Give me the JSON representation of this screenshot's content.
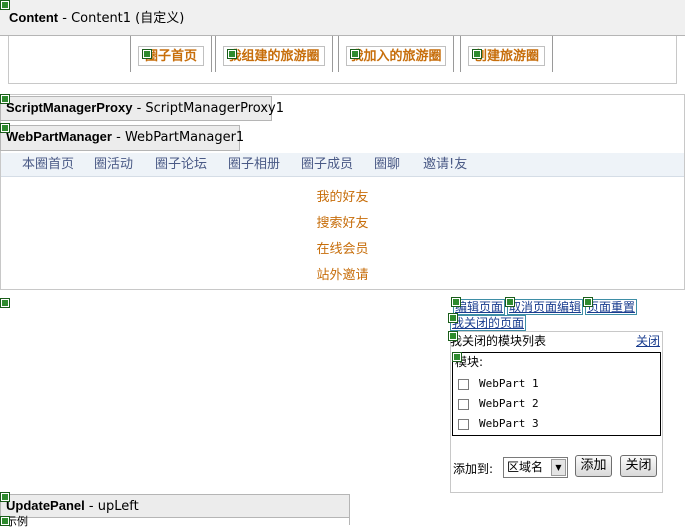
{
  "content_control": {
    "type": "Content",
    "id": "Content1 (自定义)"
  },
  "top_tabs": [
    "圈子首页",
    "我组建的旅游圈",
    "我加入的旅游圈",
    "创建旅游圈"
  ],
  "script_manager_proxy": {
    "type": "ScriptManagerProxy",
    "id": "ScriptManagerProxy1"
  },
  "webpart_manager": {
    "type": "WebPartManager",
    "id": "WebPartManager1"
  },
  "nav": [
    "本圈首页",
    "圈活动",
    "圈子论坛",
    "圈子相册",
    "圈子成员",
    "圈聊",
    "邀请!友"
  ],
  "friend_menu": [
    "我的好友",
    "搜索好友",
    "在线会员",
    "站外邀请"
  ],
  "webpart_links": [
    "编辑页面",
    "取消页面编辑",
    "页面重置"
  ],
  "closed_pages_link": "我关闭的页面",
  "catalog": {
    "title": "我关闭的模块列表",
    "close_link": "关闭",
    "modules_label": "模块:",
    "items": [
      "WebPart 1",
      "WebPart 2",
      "WebPart 3"
    ],
    "add_to_label": "添加到:",
    "zone_selected": "区域名",
    "add_button": "添加",
    "close_button": "关闭"
  },
  "update_panel": {
    "type": "UpdatePanel",
    "id": "upLeft"
  },
  "bottom_text": "示例"
}
